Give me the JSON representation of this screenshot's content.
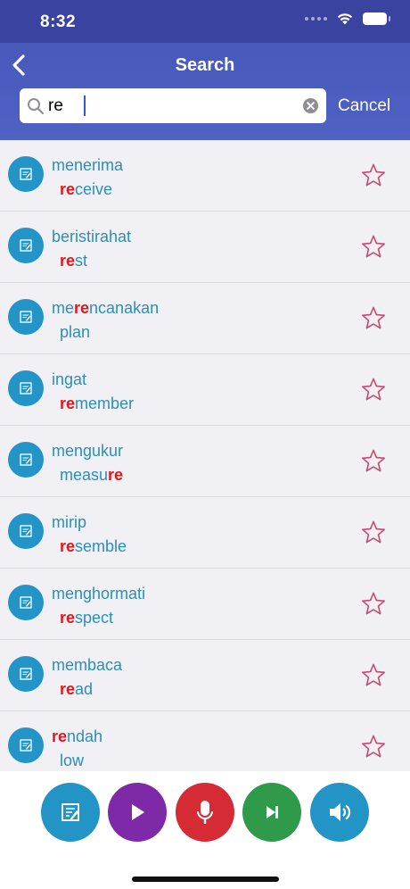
{
  "status": {
    "time": "8:32"
  },
  "nav": {
    "title": "Search"
  },
  "search": {
    "value": "re",
    "cancel_label": "Cancel"
  },
  "colors": {
    "header": "#3d4aab",
    "accent_blue": "#2295c6",
    "highlight": "#e8131b",
    "star": "#c9486e",
    "play": "#7e2aa8",
    "mic": "#d52b35",
    "next": "#2e9a4a"
  },
  "results": [
    {
      "word": [
        "",
        "",
        "menerima"
      ],
      "trans": [
        "",
        "re",
        "ceive"
      ]
    },
    {
      "word": [
        "",
        "",
        "beristirahat"
      ],
      "trans": [
        "",
        "re",
        "st"
      ]
    },
    {
      "word": [
        "me",
        "re",
        "ncanakan"
      ],
      "trans": [
        "",
        "",
        "plan"
      ]
    },
    {
      "word": [
        "",
        "",
        "ingat"
      ],
      "trans": [
        "",
        "re",
        "member"
      ]
    },
    {
      "word": [
        "",
        "",
        "mengukur"
      ],
      "trans": [
        "measu",
        "re",
        ""
      ]
    },
    {
      "word": [
        "",
        "",
        "mirip"
      ],
      "trans": [
        "",
        "re",
        "semble"
      ]
    },
    {
      "word": [
        "",
        "",
        "menghormati"
      ],
      "trans": [
        "",
        "re",
        "spect"
      ]
    },
    {
      "word": [
        "",
        "",
        "membaca"
      ],
      "trans": [
        "",
        "re",
        "ad"
      ]
    },
    {
      "word": [
        "",
        "re",
        "ndah"
      ],
      "trans": [
        "",
        "",
        "low"
      ]
    }
  ],
  "toolbar": {
    "buttons": [
      {
        "name": "notes-button",
        "icon": "edit-note-icon"
      },
      {
        "name": "play-button",
        "icon": "play-icon"
      },
      {
        "name": "record-button",
        "icon": "microphone-icon"
      },
      {
        "name": "skip-button",
        "icon": "skip-next-icon"
      },
      {
        "name": "speaker-button",
        "icon": "speaker-icon"
      }
    ]
  }
}
